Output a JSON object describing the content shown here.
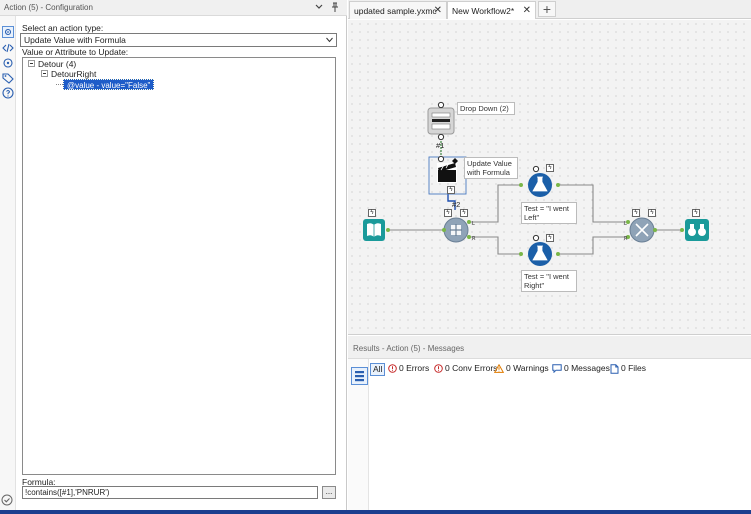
{
  "config": {
    "title": "Action (5) - Configuration",
    "select_label": "Select an action type:",
    "selected_action": "Update Value with Formula",
    "tree_label": "Value or Attribute to Update:",
    "tree": {
      "root": "Detour (4)",
      "child": "DetourRight",
      "selected": "@value - value=\"False\""
    },
    "formula_label": "Formula:",
    "formula_value": "!contains([#1],'PNRUR')",
    "formula_button": "..."
  },
  "tabs": [
    {
      "label": "updated sample.yxmc",
      "close": "✕"
    },
    {
      "label": "New Workflow2*",
      "close": "✕"
    }
  ],
  "tab_add": "+",
  "canvas": {
    "dropdown_label": "Drop Down (2)",
    "anchor1": "#1",
    "action_label": "Update Value\nwith Formula",
    "anchor2": "#2",
    "test_left": "Test = \"I went\nLeft\"",
    "test_right": "Test = \"I went\nRight\""
  },
  "results": {
    "title": "Results - Action (5) - Messages",
    "filters": {
      "all": "All",
      "errors": "0 Errors",
      "conv_errors": "0 Conv Errors",
      "warnings": "0 Warnings",
      "messages": "0 Messages",
      "files": "0 Files"
    }
  },
  "colors": {
    "tool_blue": "#1b5fa8",
    "tool_teal": "#1a9a9a",
    "connector_green": "#7ab648",
    "selection": "#1e5cc8"
  }
}
